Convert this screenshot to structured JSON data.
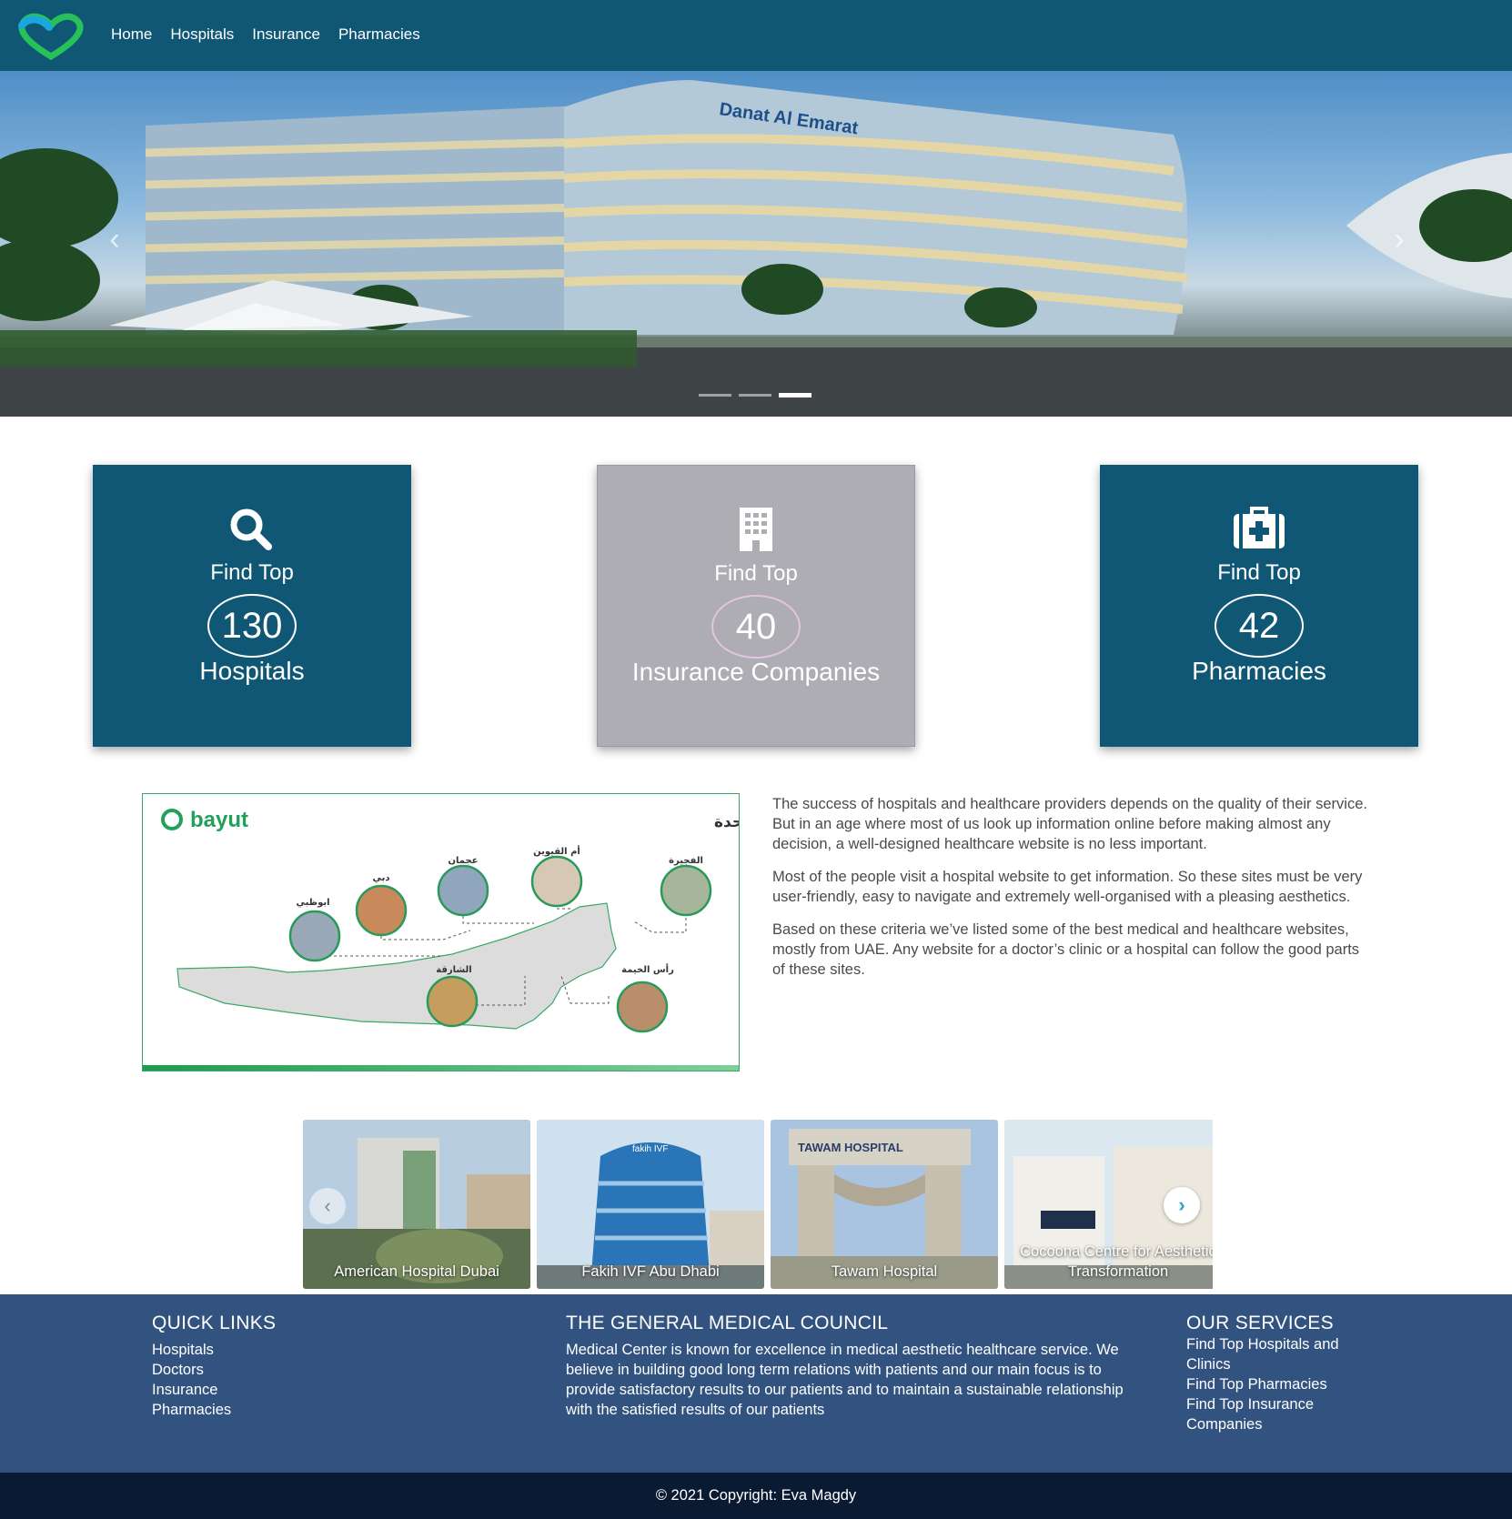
{
  "nav": {
    "links": [
      "Home",
      "Hospitals",
      "Insurance",
      "Pharmacies"
    ]
  },
  "hero": {
    "building_sign": "Danat Al Emarat",
    "active_slide": 3,
    "slide_count": 3
  },
  "stats": [
    {
      "kicker": "Find Top",
      "count": "130",
      "title": "Hospitals",
      "icon": "search-icon",
      "color": "#0f5774"
    },
    {
      "kicker": "Find Top",
      "count": "40",
      "title": "Insurance Companies",
      "icon": "building-icon",
      "color": "#adadb3"
    },
    {
      "kicker": "Find Top",
      "count": "42",
      "title": "Pharmacies",
      "icon": "medkit-icon",
      "color": "#0f5774"
    }
  ],
  "map_image": {
    "brand": "bayut",
    "heading": "الإمارات السبع لدولة الإمارات العربية المتحدة",
    "cities": [
      "ابوظبي",
      "دبي",
      "عجمان",
      "أم القيوين",
      "الفجيرة",
      "الشارقة",
      "رأس الخيمة"
    ]
  },
  "about": {
    "paragraphs": [
      "The success of hospitals and healthcare providers depends on the quality of their service. But in an age where most of us look up information online before making almost any decision, a well-designed healthcare website is no less important.",
      "Most of the people visit a hospital website to get information. So these sites must be very user-friendly, easy to navigate and extremely well-organised with a pleasing aesthetics.",
      "Based on these criteria we’ve listed some of the best medical and healthcare websites, mostly from UAE. Any website for a doctor’s clinic or a hospital can follow the good parts of these sites."
    ]
  },
  "hospitals": [
    {
      "name": "American Hospital Dubai"
    },
    {
      "name": "Fakih IVF Abu Dhabi",
      "sign": "fakih IVF"
    },
    {
      "name": "Tawam Hospital",
      "sign": "TAWAM HOSPITAL"
    },
    {
      "name": "Cocoona Centre for Aesthetic Transformation"
    }
  ],
  "footer": {
    "quick_links_title": "QUICK LINKS",
    "quick_links": [
      "Hospitals",
      "Doctors",
      "Insurance",
      "Pharmacies"
    ],
    "council_title": "THE GENERAL MEDICAL COUNCIL",
    "council_text": "Medical Center is known for excellence in medical aesthetic healthcare service. We believe in building good long term relations with patients and our main focus is to provide satisfactory results to our patients and to maintain a sustainable relationship with the satisfied results of our patients",
    "services_title": "OUR SERVICES",
    "services": [
      "Find Top Hospitals and Clinics",
      "Find Top Pharmacies",
      "Find Top Insurance Companies"
    ],
    "copyright": "© 2021 Copyright: Eva Magdy"
  },
  "colors": {
    "navbar": "#0f5774",
    "footer": "#32537f",
    "copyright_bar": "#0b1a33",
    "card_blue": "#0f5774",
    "card_gray": "#adadb3"
  }
}
